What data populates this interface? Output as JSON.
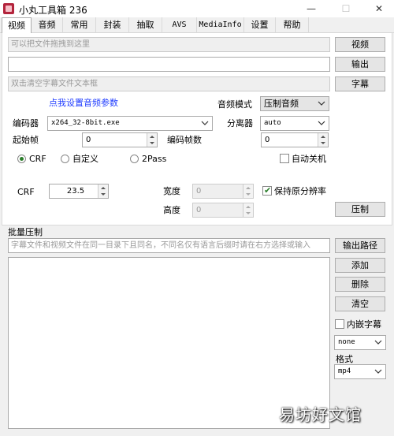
{
  "window": {
    "title": "小丸工具箱 236",
    "minimize": "—",
    "maximize": "☐",
    "close": "✕"
  },
  "tabs": [
    "视频",
    "音频",
    "常用",
    "封装",
    "抽取",
    "AVS",
    "MediaInfo",
    "设置",
    "帮助"
  ],
  "video": {
    "drag_hint": "可以把文件拖拽到这里",
    "output_path": "",
    "subtitle_hint": "双击清空字幕文件文本框",
    "buttons": {
      "video": "视频",
      "output": "输出",
      "subtitle": "字幕",
      "encode": "压制"
    },
    "audio_settings_link": "点我设置音频参数",
    "audio_mode_label": "音频模式",
    "audio_mode_value": "压制音频",
    "encoder_label": "编码器",
    "encoder_value": "x264_32-8bit.exe",
    "demuxer_label": "分离器",
    "demuxer_value": "auto",
    "start_frame_label": "起始帧",
    "start_frame_value": "0",
    "encode_frames_label": "编码帧数",
    "encode_frames_value": "0",
    "rate_modes": [
      "CRF",
      "自定义",
      "2Pass"
    ],
    "rate_mode_selected": "CRF",
    "auto_shutdown_label": "自动关机",
    "auto_shutdown_checked": false,
    "crf_label": "CRF",
    "crf_value": "23.5",
    "width_label": "宽度",
    "width_value": "0",
    "height_label": "高度",
    "height_value": "0",
    "keep_res_label": "保持原分辨率",
    "keep_res_checked": true
  },
  "batch": {
    "title": "批量压制",
    "hint": "字幕文件和视频文件在同一目录下且同名，不同名仅有语言后缀时请在右方选择或输入",
    "buttons": {
      "output_path": "输出路径",
      "add": "添加",
      "delete": "删除",
      "clear": "清空"
    },
    "embed_subtitle_label": "内嵌字幕",
    "embed_subtitle_checked": false,
    "subtitle_lang_value": "none",
    "format_label": "格式",
    "format_value": "mp4"
  },
  "watermark": "易坊好文馆"
}
